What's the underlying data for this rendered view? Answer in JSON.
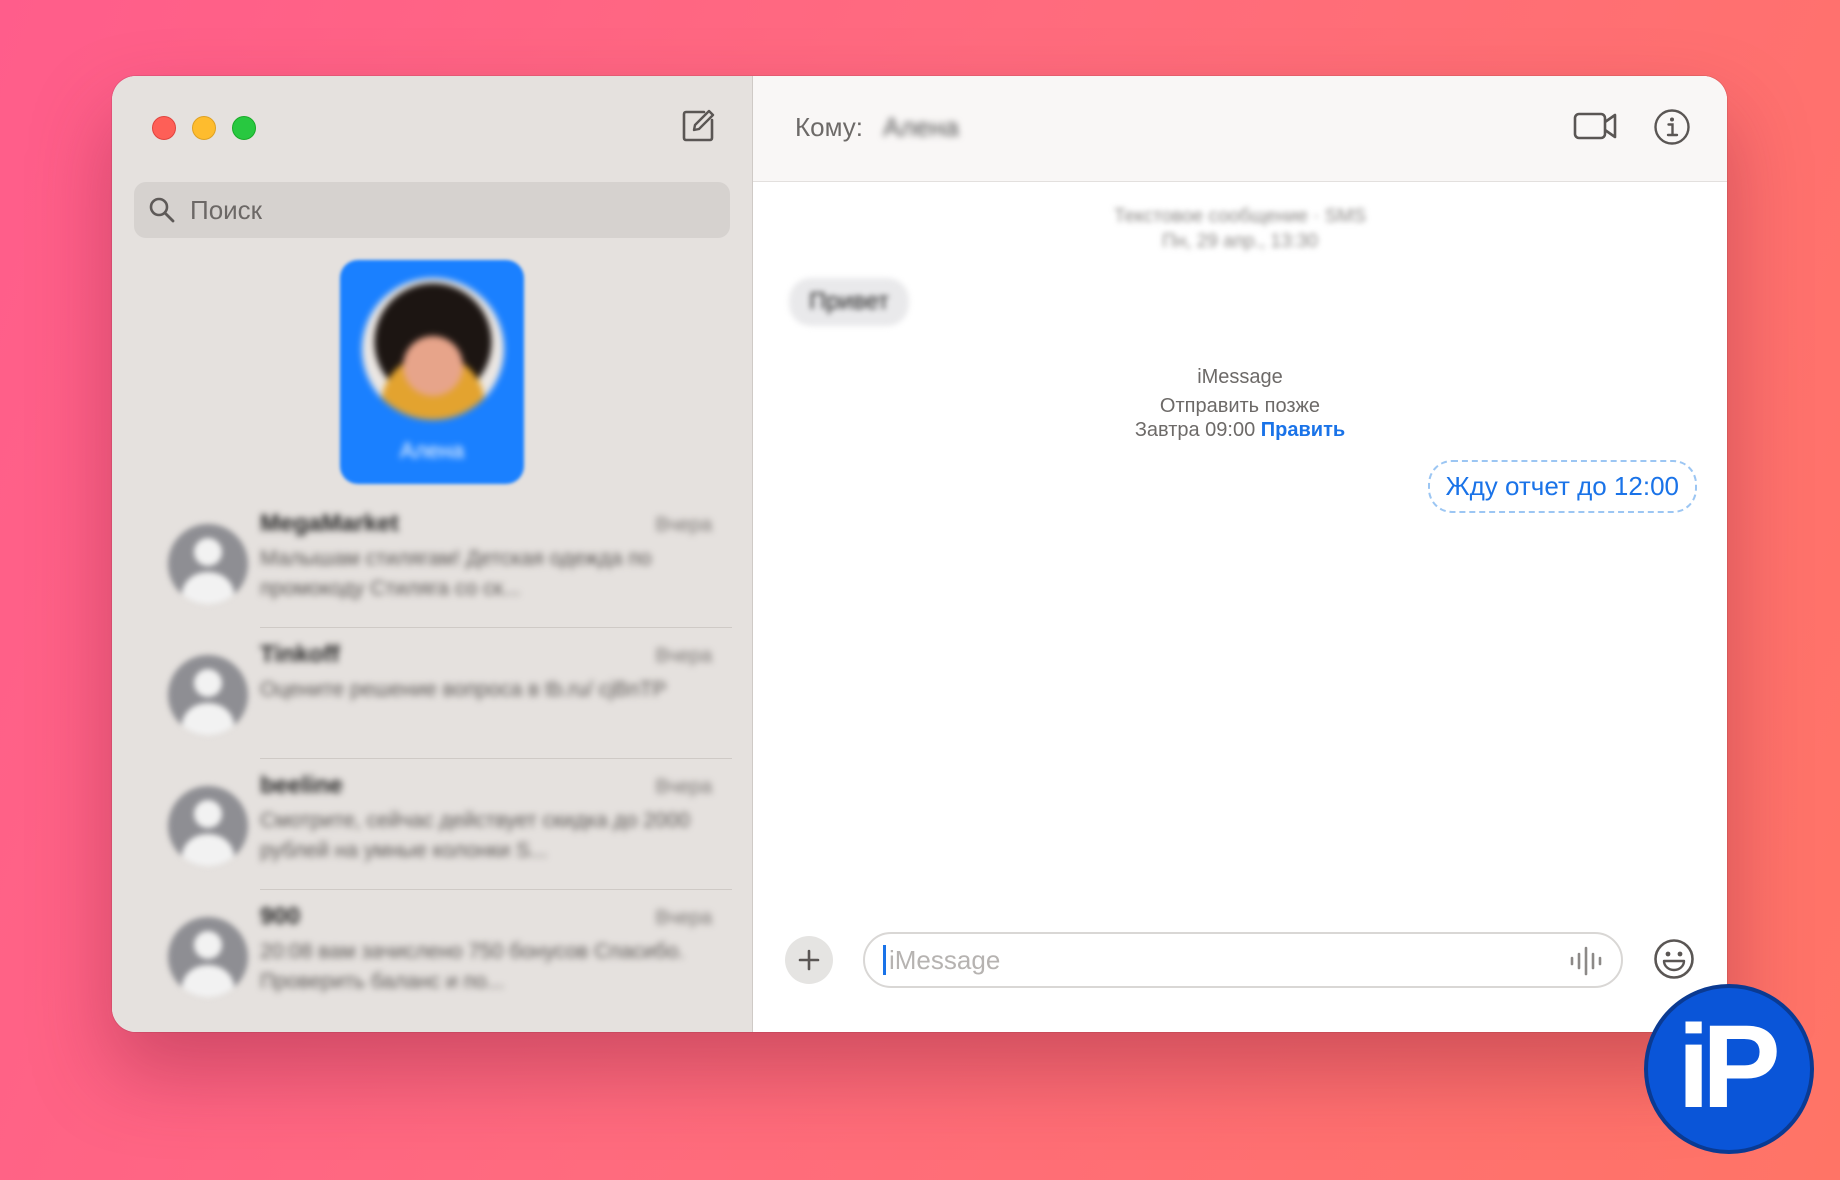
{
  "sidebar": {
    "search": {
      "placeholder": "Поиск"
    },
    "pinned": {
      "name": "Алена"
    },
    "conversations": [
      {
        "name": "MegaMarket",
        "time": "Вчера",
        "preview": "Малышам стилягам! Детская одежда по промокоду Стиляга со ск..."
      },
      {
        "name": "Tinkoff",
        "time": "Вчера",
        "preview": "Оцените решение вопроса в tb.ru/ cjBnTP"
      },
      {
        "name": "beeline",
        "time": "Вчера",
        "preview": "Смотрите, сейчас действует скидка до 2000 рублей на умные колонки S..."
      },
      {
        "name": "900",
        "time": "Вчера",
        "preview": "20:08 вам зачислено 750 бонусов Спасибо. Проверить баланс и по..."
      }
    ]
  },
  "chat": {
    "to_label": "Кому:",
    "recipient": "Алена",
    "sms_meta": {
      "service": "Текстовое сообщение · SMS",
      "date": "Пн, 29 апр., 13:30"
    },
    "incoming_message": "Привет",
    "imessage_meta": {
      "service": "iMessage",
      "send_later": "Отправить позже",
      "scheduled_time": "Завтра 09:00",
      "edit_label": "Править"
    },
    "scheduled_message": "Жду отчет до 12:00",
    "composer": {
      "placeholder": "iMessage"
    }
  },
  "watermark": {
    "text": "iP"
  },
  "colors": {
    "background_left": "#ff5d8b",
    "background_right": "#ff7466",
    "accent": "#1a73e8",
    "pinned_tile": "#1a80ff",
    "watermark": "#0a55d8"
  }
}
